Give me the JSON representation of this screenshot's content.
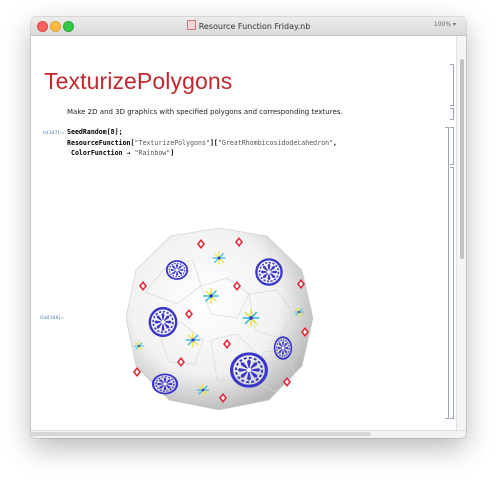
{
  "window": {
    "title": "Resource Function Friday.nb",
    "zoom": "100%"
  },
  "notebook": {
    "title": "TexturizePolygons",
    "description": "Make 2D and 3D graphics with specified polygons and corresponding textures.",
    "input_label": "In[347]:=",
    "output_label": "Out[348]=",
    "code": {
      "line1": "SeedRandom[8];",
      "line2_prefix": "ResourceFunction[",
      "line2_func": "\"TexturizePolygons\"",
      "line2_mid": "][",
      "line2_arg": "\"GreatRhombicosidodecahedron\"",
      "line2_suffix": ",",
      "line3_prefix": " ColorFunction → ",
      "line3_arg": "\"Rainbow\"",
      "line3_suffix": "]"
    }
  },
  "colors": {
    "title_red": "#c1272d",
    "label_blue": "#4a79b8",
    "texture_blue": "#3a38c8",
    "texture_red": "#e02a3a",
    "texture_yellow": "#e8e23a",
    "texture_cyan": "#2fb8d8"
  }
}
